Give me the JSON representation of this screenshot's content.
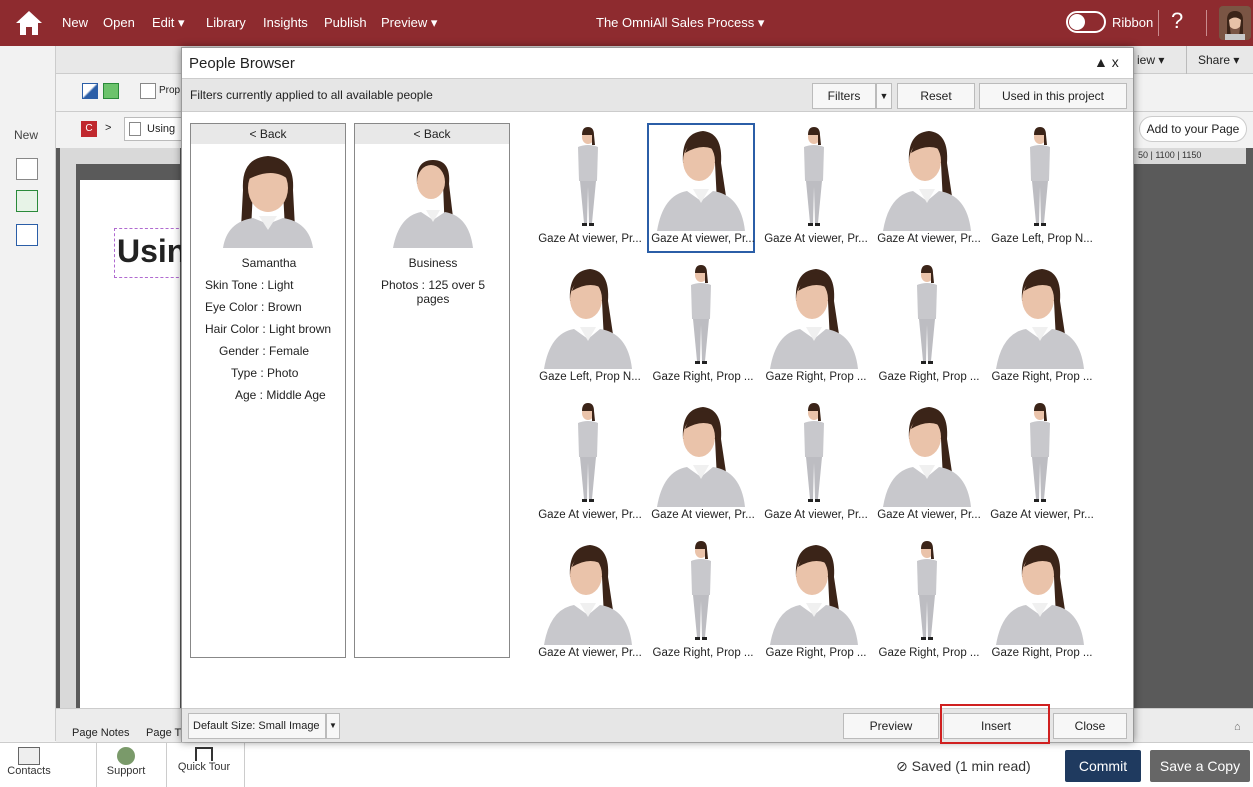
{
  "topbar": {
    "menu": [
      "New",
      "Open",
      "Edit ▾",
      "Library",
      "Insights",
      "Publish",
      "Preview ▾"
    ],
    "project_title": "The OmniAll Sales Process ▾",
    "ribbon_label": "Ribbon",
    "help": "?"
  },
  "toolbar": {
    "view_label": "iew ▾",
    "share_label": "Share ▾",
    "prop_label": "Prop",
    "crumb_using": "Using",
    "add_to_page": "Add to your Page",
    "ruler_right": "50 | 1100 | 1150"
  },
  "leftrail": {
    "new_label": "New"
  },
  "canvas": {
    "heading_partial": "Usin"
  },
  "bottomstrip": {
    "page_notes": "Page Notes",
    "page_t": "Page T"
  },
  "footer": {
    "contacts": "Contacts",
    "support": "Support",
    "quick_tour": "Quick Tour",
    "saved": "⊘ Saved (1 min read)",
    "commit": "Commit",
    "save_copy": "Save a Copy"
  },
  "dialog": {
    "title": "People Browser",
    "controls": "▲ x",
    "filter_text": "Filters currently applied to all available people",
    "filters_btn": "Filters",
    "reset_btn": "Reset",
    "used_btn": "Used in this project",
    "person_card": {
      "back": "< Back",
      "name": "Samantha",
      "attributes": [
        "Skin Tone : Light",
        "Eye Color : Brown",
        "Hair Color : Light brown",
        "Gender : Female",
        "Type : Photo",
        "Age : Middle Age"
      ]
    },
    "collection_card": {
      "back": "< Back",
      "name": "Business",
      "photos_line1": "Photos : 125 over 5",
      "photos_line2": "pages"
    },
    "thumbnails": [
      {
        "caption": "Gaze At viewer, Pr...",
        "pose": "full"
      },
      {
        "caption": "Gaze At viewer, Pr...",
        "pose": "bust",
        "selected": true
      },
      {
        "caption": "Gaze At viewer, Pr...",
        "pose": "full"
      },
      {
        "caption": "Gaze At viewer, Pr...",
        "pose": "bust"
      },
      {
        "caption": "Gaze Left, Prop N...",
        "pose": "full"
      },
      {
        "caption": "Gaze Left, Prop N...",
        "pose": "bust"
      },
      {
        "caption": "Gaze Right, Prop ...",
        "pose": "full"
      },
      {
        "caption": "Gaze Right, Prop ...",
        "pose": "bust"
      },
      {
        "caption": "Gaze Right, Prop ...",
        "pose": "full"
      },
      {
        "caption": "Gaze Right, Prop ...",
        "pose": "bust"
      },
      {
        "caption": "Gaze At viewer, Pr...",
        "pose": "full"
      },
      {
        "caption": "Gaze At viewer, Pr...",
        "pose": "bust"
      },
      {
        "caption": "Gaze At viewer, Pr...",
        "pose": "full"
      },
      {
        "caption": "Gaze At viewer, Pr...",
        "pose": "bust"
      },
      {
        "caption": "Gaze At viewer, Pr...",
        "pose": "full"
      },
      {
        "caption": "Gaze At viewer, Pr...",
        "pose": "bust"
      },
      {
        "caption": "Gaze Right, Prop ...",
        "pose": "full"
      },
      {
        "caption": "Gaze Right, Prop ...",
        "pose": "bust"
      },
      {
        "caption": "Gaze Right, Prop ...",
        "pose": "full"
      },
      {
        "caption": "Gaze Right, Prop ...",
        "pose": "bust"
      }
    ],
    "default_size": "Default Size: Small Image",
    "preview_btn": "Preview",
    "insert_btn": "Insert",
    "close_btn": "Close"
  },
  "colors": {
    "brand": "#8e2b2f",
    "commit": "#1f3a5f",
    "selection": "#2b5ea7",
    "highlight": "#d02020"
  }
}
